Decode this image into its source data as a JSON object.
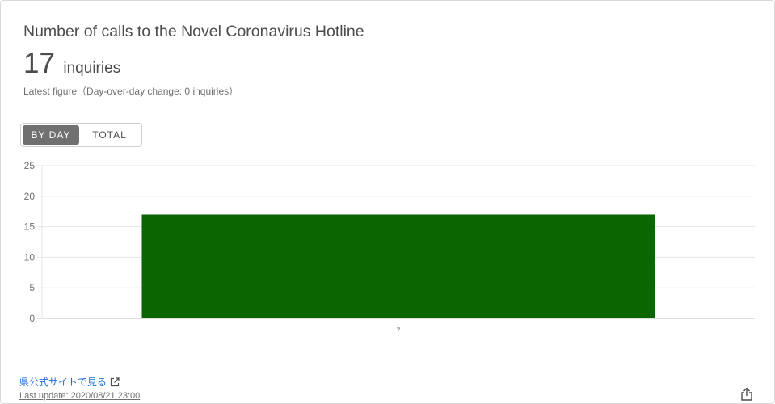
{
  "header": {
    "title": "Number of calls to the Novel Coronavirus Hotline",
    "value": "17",
    "unit": "inquiries",
    "subtitle": "Latest figure（Day-over-day change: 0 inquiries）"
  },
  "toggle": {
    "by_day_label": "BY DAY",
    "total_label": "TOTAL",
    "active": "BY DAY"
  },
  "chart_data": {
    "type": "bar",
    "categories": [
      "7"
    ],
    "values": [
      17
    ],
    "ylim": [
      0,
      25
    ],
    "yticks": [
      0,
      5,
      10,
      15,
      20,
      25
    ],
    "grid": true,
    "bar_color": "#0a6600"
  },
  "footer": {
    "link_label": "県公式サイトで見る",
    "last_update": "Last update: 2020/08/21 23:00"
  },
  "colors": {
    "accent": "#707070",
    "link": "#1b6dd1",
    "bar": "#0a6600"
  }
}
